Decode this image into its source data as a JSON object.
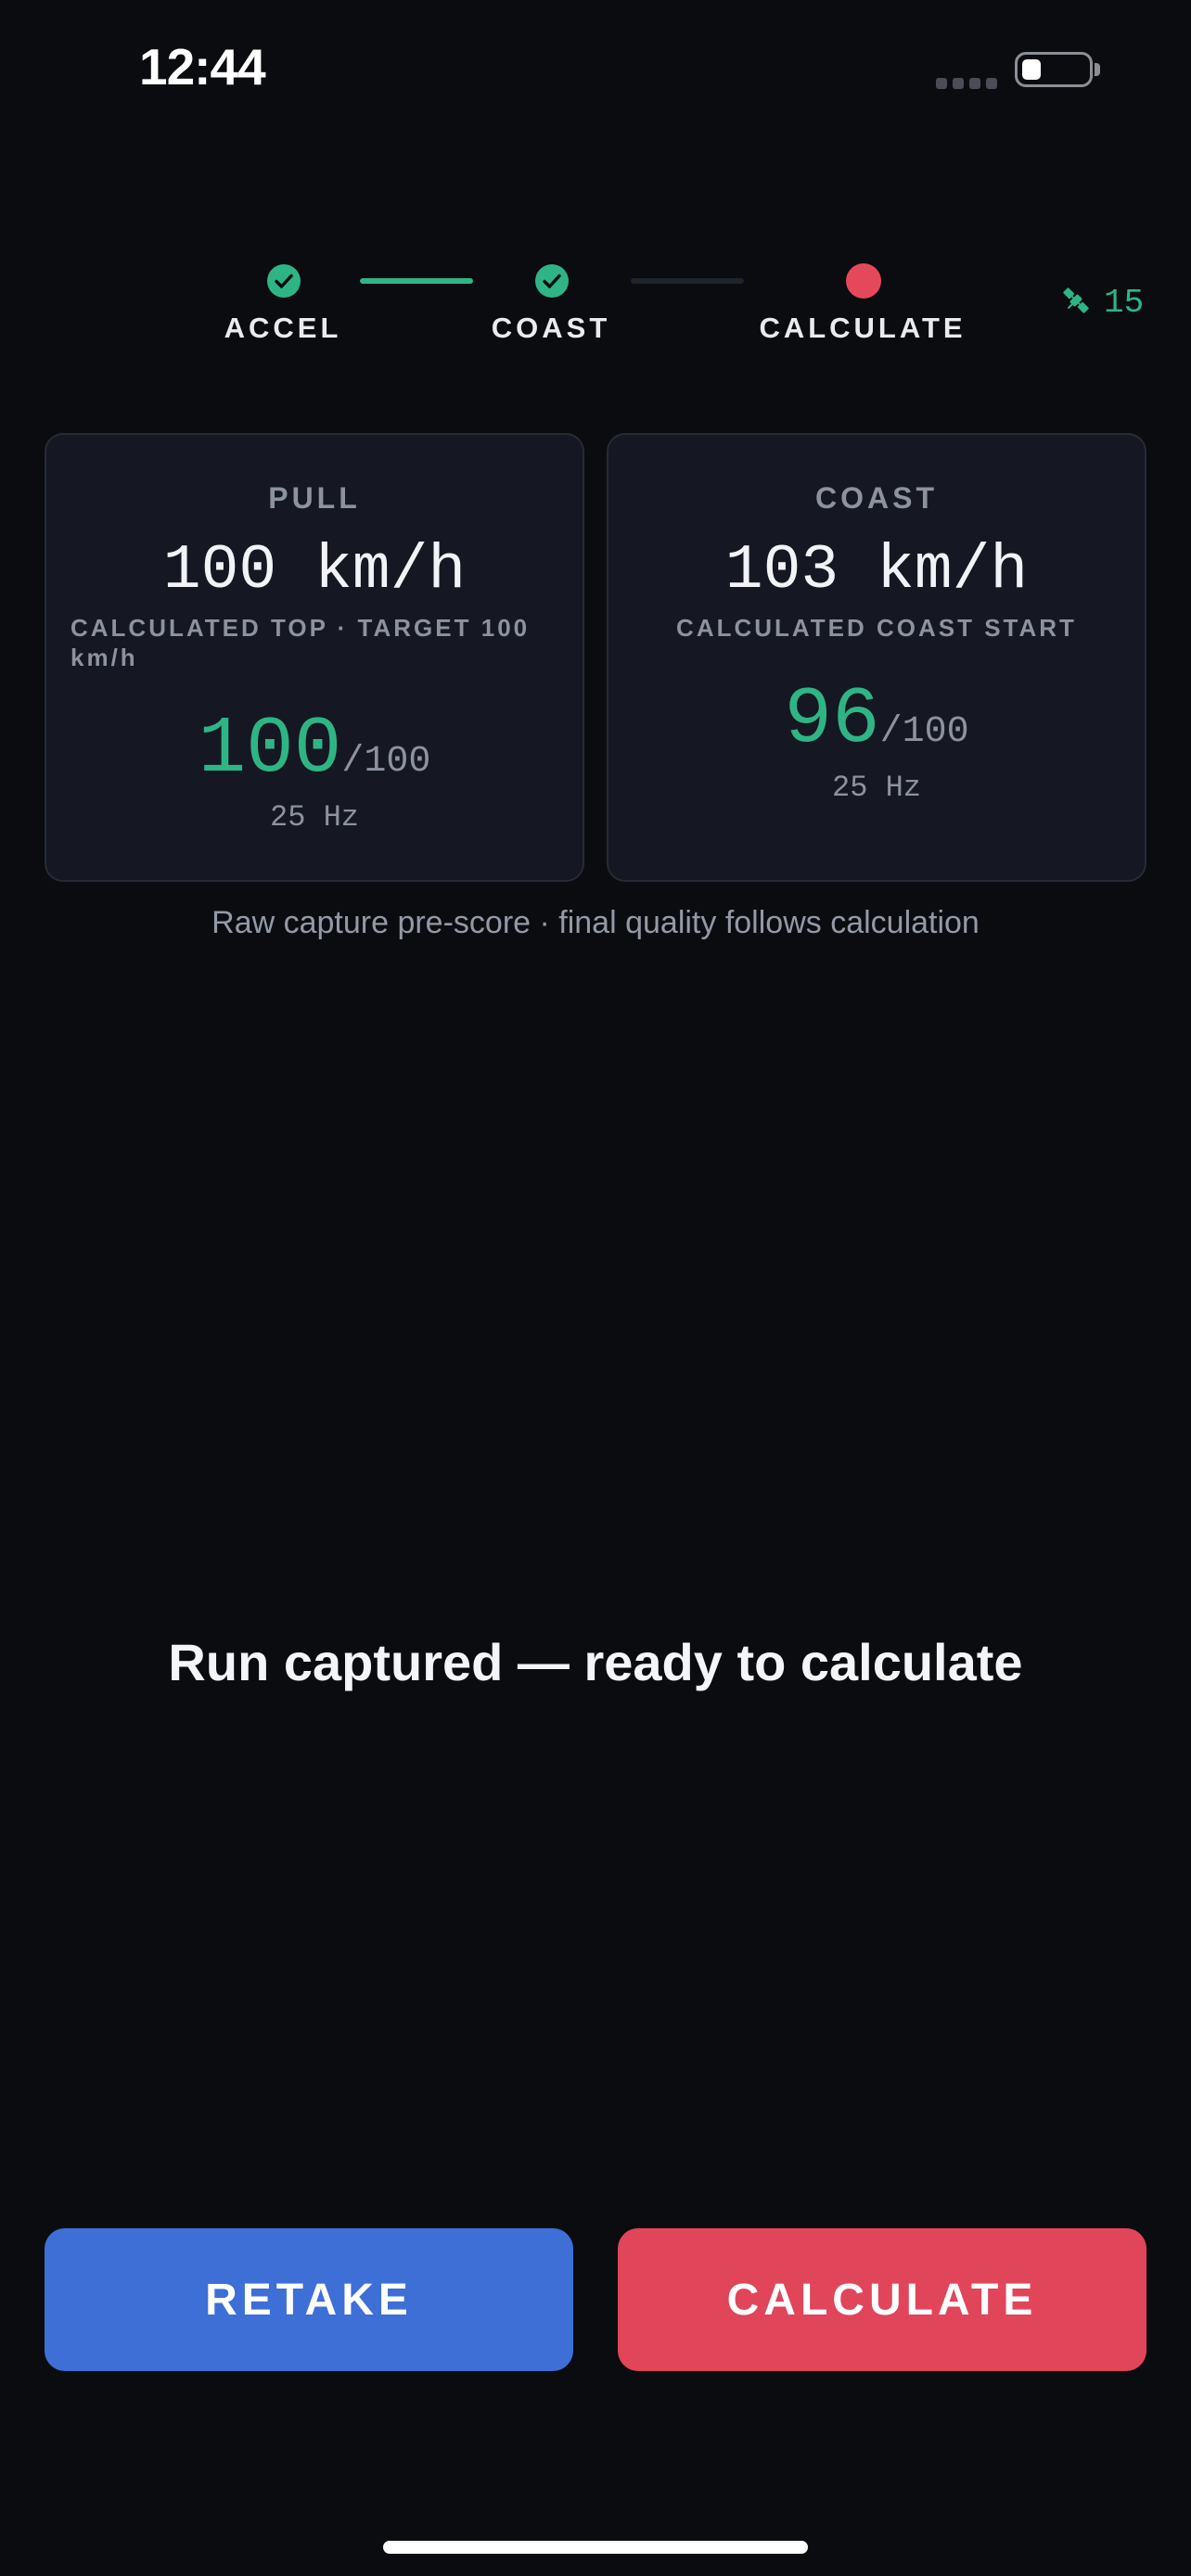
{
  "status_bar": {
    "time": "12:44"
  },
  "stepper": {
    "steps": [
      {
        "label": "ACCEL",
        "state": "done"
      },
      {
        "label": "COAST",
        "state": "done"
      },
      {
        "label": "CALCULATE",
        "state": "current"
      }
    ],
    "satellite_count": "15",
    "colors": {
      "done": "#2fb585",
      "current": "#e5485a",
      "pending_line": "#1f232c"
    }
  },
  "cards": {
    "pull": {
      "title": "PULL",
      "speed": "100 km/h",
      "subtitle": "CALCULATED TOP · TARGET 100 km/h",
      "score": "100",
      "score_max": "/100",
      "rate": "25 Hz"
    },
    "coast": {
      "title": "COAST",
      "speed": "103 km/h",
      "subtitle": "CALCULATED COAST START",
      "score": "96",
      "score_max": "/100",
      "rate": "25 Hz"
    }
  },
  "note": "Raw capture pre-score · final quality follows calculation",
  "headline": "Run captured — ready to calculate",
  "buttons": {
    "retake": "RETAKE",
    "calculate": "CALCULATE"
  },
  "colors": {
    "background": "#0b0c10",
    "accent_green": "#2fb585",
    "retake_blue": "#3d6fd6",
    "calculate_red": "#e0455a"
  }
}
